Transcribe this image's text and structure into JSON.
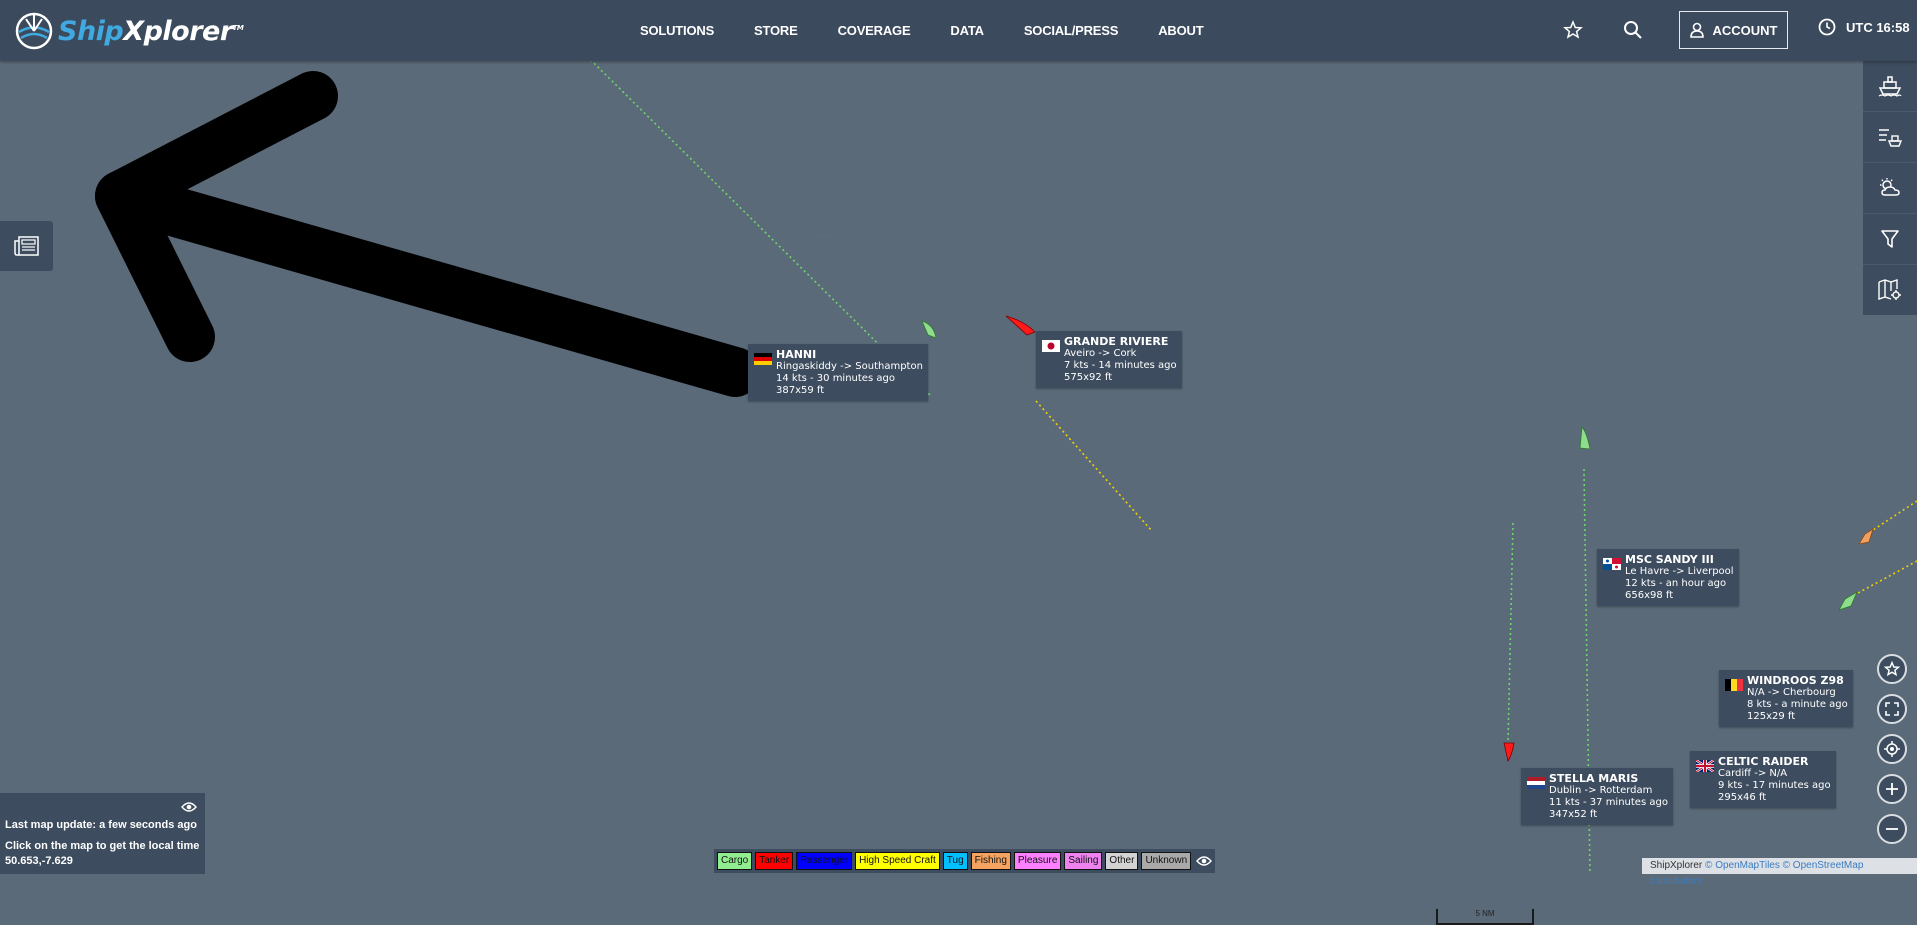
{
  "header": {
    "brand_ship": "Ship",
    "brand_xplorer": "Xplorer",
    "brand_tm": "TM",
    "nav": [
      "SOLUTIONS",
      "STORE",
      "COVERAGE",
      "DATA",
      "SOCIAL/PRESS",
      "ABOUT"
    ],
    "account_label": "ACCOUNT",
    "clock": "UTC 16:58"
  },
  "ships": [
    {
      "name": "HANNI",
      "route": "Ringaskiddy -> Southampton",
      "status": "14 kts - 30 minutes ago",
      "size": "387x59 ft",
      "flag": "germany",
      "type": "Cargo",
      "color": "#8fdc8f"
    },
    {
      "name": "GRANDE RIVIERE",
      "route": "Aveiro -> Cork",
      "status": "7 kts - 14 minutes ago",
      "size": "575x92 ft",
      "flag": "japan",
      "type": "Tanker",
      "color": "#ff1a1a"
    },
    {
      "name": "MSC SANDY III",
      "route": "Le Havre -> Liverpool",
      "status": "12 kts - an hour ago",
      "size": "656x98 ft",
      "flag": "panama",
      "type": "Cargo",
      "color": "#8fdc8f"
    },
    {
      "name": "WINDROOS Z98",
      "route": "N/A -> Cherbourg",
      "status": "8 kts - a minute ago",
      "size": "125x29 ft",
      "flag": "belgium",
      "type": "Fishing",
      "color": "#f0a060"
    },
    {
      "name": "CELTIC RAIDER",
      "route": "Cardiff -> N/A",
      "status": "9 kts - 17 minutes ago",
      "size": "295x46 ft",
      "flag": "uk",
      "type": "Cargo",
      "color": "#8fdc8f"
    },
    {
      "name": "STELLA MARIS",
      "route": "Dublin -> Rotterdam",
      "status": "11 kts - 37 minutes ago",
      "size": "347x52 ft",
      "flag": "netherlands",
      "type": "Tanker",
      "color": "#ff1a1a"
    }
  ],
  "info": {
    "last_update": "Last map update: a few seconds ago",
    "click_hint": "Click on the map to get the local time",
    "coords": "50.653,-7.629"
  },
  "legend": [
    {
      "label": "Cargo",
      "color": "#90ee90"
    },
    {
      "label": "Tanker",
      "color": "#ff0000"
    },
    {
      "label": "Passenger",
      "color": "#0000ff"
    },
    {
      "label": "High Speed Craft",
      "color": "#ffff00"
    },
    {
      "label": "Tug",
      "color": "#00bfff"
    },
    {
      "label": "Fishing",
      "color": "#f4a460"
    },
    {
      "label": "Pleasure",
      "color": "#ff80ff"
    },
    {
      "label": "Sailing",
      "color": "#ee82ee"
    },
    {
      "label": "Other",
      "color": "#d3d3d3"
    },
    {
      "label": "Unknown",
      "color": "#a9a9a9"
    }
  ],
  "scale_label": "5 NM",
  "attribution": {
    "app": "ShipXplorer",
    "tiles": "© OpenMapTiles",
    "osm": "© OpenStreetMap contributors"
  }
}
